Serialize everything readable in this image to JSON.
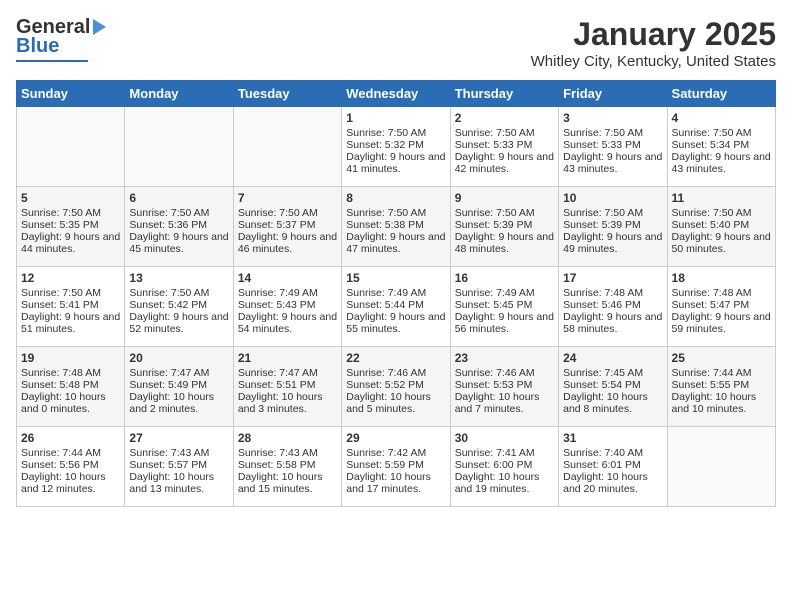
{
  "header": {
    "logo_general": "General",
    "logo_blue": "Blue",
    "month": "January 2025",
    "location": "Whitley City, Kentucky, United States"
  },
  "days_of_week": [
    "Sunday",
    "Monday",
    "Tuesday",
    "Wednesday",
    "Thursday",
    "Friday",
    "Saturday"
  ],
  "weeks": [
    [
      {
        "day": "",
        "content": ""
      },
      {
        "day": "",
        "content": ""
      },
      {
        "day": "",
        "content": ""
      },
      {
        "day": "1",
        "content": "Sunrise: 7:50 AM\nSunset: 5:32 PM\nDaylight: 9 hours and 41 minutes."
      },
      {
        "day": "2",
        "content": "Sunrise: 7:50 AM\nSunset: 5:33 PM\nDaylight: 9 hours and 42 minutes."
      },
      {
        "day": "3",
        "content": "Sunrise: 7:50 AM\nSunset: 5:33 PM\nDaylight: 9 hours and 43 minutes."
      },
      {
        "day": "4",
        "content": "Sunrise: 7:50 AM\nSunset: 5:34 PM\nDaylight: 9 hours and 43 minutes."
      }
    ],
    [
      {
        "day": "5",
        "content": "Sunrise: 7:50 AM\nSunset: 5:35 PM\nDaylight: 9 hours and 44 minutes."
      },
      {
        "day": "6",
        "content": "Sunrise: 7:50 AM\nSunset: 5:36 PM\nDaylight: 9 hours and 45 minutes."
      },
      {
        "day": "7",
        "content": "Sunrise: 7:50 AM\nSunset: 5:37 PM\nDaylight: 9 hours and 46 minutes."
      },
      {
        "day": "8",
        "content": "Sunrise: 7:50 AM\nSunset: 5:38 PM\nDaylight: 9 hours and 47 minutes."
      },
      {
        "day": "9",
        "content": "Sunrise: 7:50 AM\nSunset: 5:39 PM\nDaylight: 9 hours and 48 minutes."
      },
      {
        "day": "10",
        "content": "Sunrise: 7:50 AM\nSunset: 5:39 PM\nDaylight: 9 hours and 49 minutes."
      },
      {
        "day": "11",
        "content": "Sunrise: 7:50 AM\nSunset: 5:40 PM\nDaylight: 9 hours and 50 minutes."
      }
    ],
    [
      {
        "day": "12",
        "content": "Sunrise: 7:50 AM\nSunset: 5:41 PM\nDaylight: 9 hours and 51 minutes."
      },
      {
        "day": "13",
        "content": "Sunrise: 7:50 AM\nSunset: 5:42 PM\nDaylight: 9 hours and 52 minutes."
      },
      {
        "day": "14",
        "content": "Sunrise: 7:49 AM\nSunset: 5:43 PM\nDaylight: 9 hours and 54 minutes."
      },
      {
        "day": "15",
        "content": "Sunrise: 7:49 AM\nSunset: 5:44 PM\nDaylight: 9 hours and 55 minutes."
      },
      {
        "day": "16",
        "content": "Sunrise: 7:49 AM\nSunset: 5:45 PM\nDaylight: 9 hours and 56 minutes."
      },
      {
        "day": "17",
        "content": "Sunrise: 7:48 AM\nSunset: 5:46 PM\nDaylight: 9 hours and 58 minutes."
      },
      {
        "day": "18",
        "content": "Sunrise: 7:48 AM\nSunset: 5:47 PM\nDaylight: 9 hours and 59 minutes."
      }
    ],
    [
      {
        "day": "19",
        "content": "Sunrise: 7:48 AM\nSunset: 5:48 PM\nDaylight: 10 hours and 0 minutes."
      },
      {
        "day": "20",
        "content": "Sunrise: 7:47 AM\nSunset: 5:49 PM\nDaylight: 10 hours and 2 minutes."
      },
      {
        "day": "21",
        "content": "Sunrise: 7:47 AM\nSunset: 5:51 PM\nDaylight: 10 hours and 3 minutes."
      },
      {
        "day": "22",
        "content": "Sunrise: 7:46 AM\nSunset: 5:52 PM\nDaylight: 10 hours and 5 minutes."
      },
      {
        "day": "23",
        "content": "Sunrise: 7:46 AM\nSunset: 5:53 PM\nDaylight: 10 hours and 7 minutes."
      },
      {
        "day": "24",
        "content": "Sunrise: 7:45 AM\nSunset: 5:54 PM\nDaylight: 10 hours and 8 minutes."
      },
      {
        "day": "25",
        "content": "Sunrise: 7:44 AM\nSunset: 5:55 PM\nDaylight: 10 hours and 10 minutes."
      }
    ],
    [
      {
        "day": "26",
        "content": "Sunrise: 7:44 AM\nSunset: 5:56 PM\nDaylight: 10 hours and 12 minutes."
      },
      {
        "day": "27",
        "content": "Sunrise: 7:43 AM\nSunset: 5:57 PM\nDaylight: 10 hours and 13 minutes."
      },
      {
        "day": "28",
        "content": "Sunrise: 7:43 AM\nSunset: 5:58 PM\nDaylight: 10 hours and 15 minutes."
      },
      {
        "day": "29",
        "content": "Sunrise: 7:42 AM\nSunset: 5:59 PM\nDaylight: 10 hours and 17 minutes."
      },
      {
        "day": "30",
        "content": "Sunrise: 7:41 AM\nSunset: 6:00 PM\nDaylight: 10 hours and 19 minutes."
      },
      {
        "day": "31",
        "content": "Sunrise: 7:40 AM\nSunset: 6:01 PM\nDaylight: 10 hours and 20 minutes."
      },
      {
        "day": "",
        "content": ""
      }
    ]
  ]
}
